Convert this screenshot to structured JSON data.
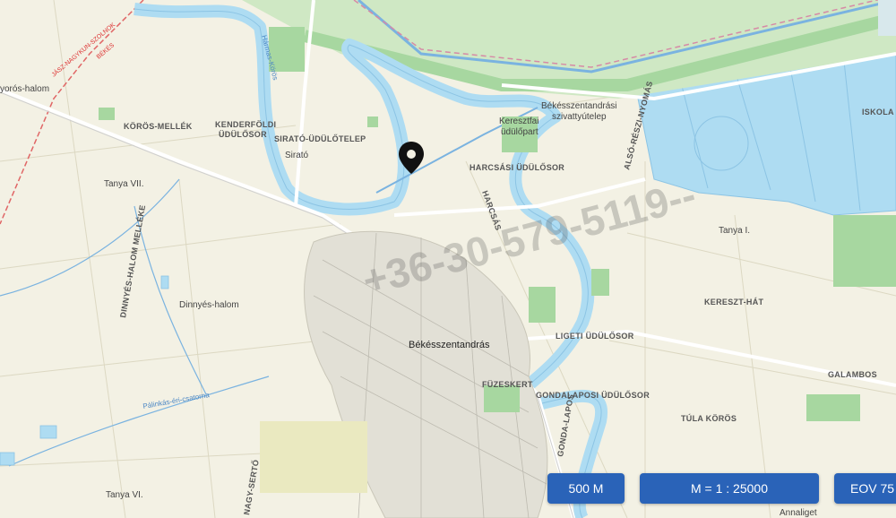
{
  "labels": {
    "koros_mellek": "KÖRÖS-MELLÉK",
    "kenderfoldi": "KENDERFÖLDI",
    "udulosor1": "ÜDÜLŐSOR",
    "sirato_udulotelep": "SIRATÓ-ÜDÜLŐTELEP",
    "sirato": "Sirató",
    "tanya_vii": "Tanya VII.",
    "dinnyes_halom_melleke": "DINNYÉS-HALOM MELLÉKE",
    "dinnyes_halom": "Dinnyés-halom",
    "gyoros_halom": "yorós-halom",
    "harcsasi": "HARCSÁSI ÜDÜLŐSOR",
    "harcsas": "HARCSÁS",
    "keresztfai": "Keresztfai",
    "udulopart": "üdülőpart",
    "bekesszentandrasi": "Békésszentandrási",
    "szivattyutelep": "szivattyútelep",
    "alsoreszi_nyomas": "ALSÓ-RÉSZI-NYOMÁS",
    "iskola": "ISKOLA",
    "tanya_i": "Tanya I.",
    "kereszt_hat": "KERESZT-HÁT",
    "bekesszentandras": "Békésszentandrás",
    "ligeti": "LIGETI ÜDÜLŐSOR",
    "fuzeskert": "FÜZESKERT",
    "gondalaposi": "GONDALAPOSI ÜDÜLŐSOR",
    "gonda_lapos": "GONDA-LAPOS",
    "galambos": "GALAMBOS",
    "tula_koros": "TÚLA KÖRÖS",
    "nagy_serto": "NAGY-SERTŐ",
    "tanya_vi": "Tanya VI.",
    "annaliget": "Annaliget",
    "palinkas_er": "Pálinkás-éri-csatorna",
    "hafokai": "Hármas-Körös",
    "red_road": "JÁSZ-NAGYKUN-SZOLNOK",
    "red_road2": "BÉKÉS"
  },
  "watermark": "+36-30-579-5119--",
  "controls": {
    "scale_bar": "500 M",
    "ratio": "M = 1 : 25000",
    "projection": "EOV   75"
  },
  "colors": {
    "background": "#f3f1e4",
    "water": "#aedcf2",
    "river_edge": "#8cc4e4",
    "green_strip": "#a7d7a0",
    "button": "#2a63b8"
  },
  "icons": {
    "marker": "map-pin-icon"
  }
}
